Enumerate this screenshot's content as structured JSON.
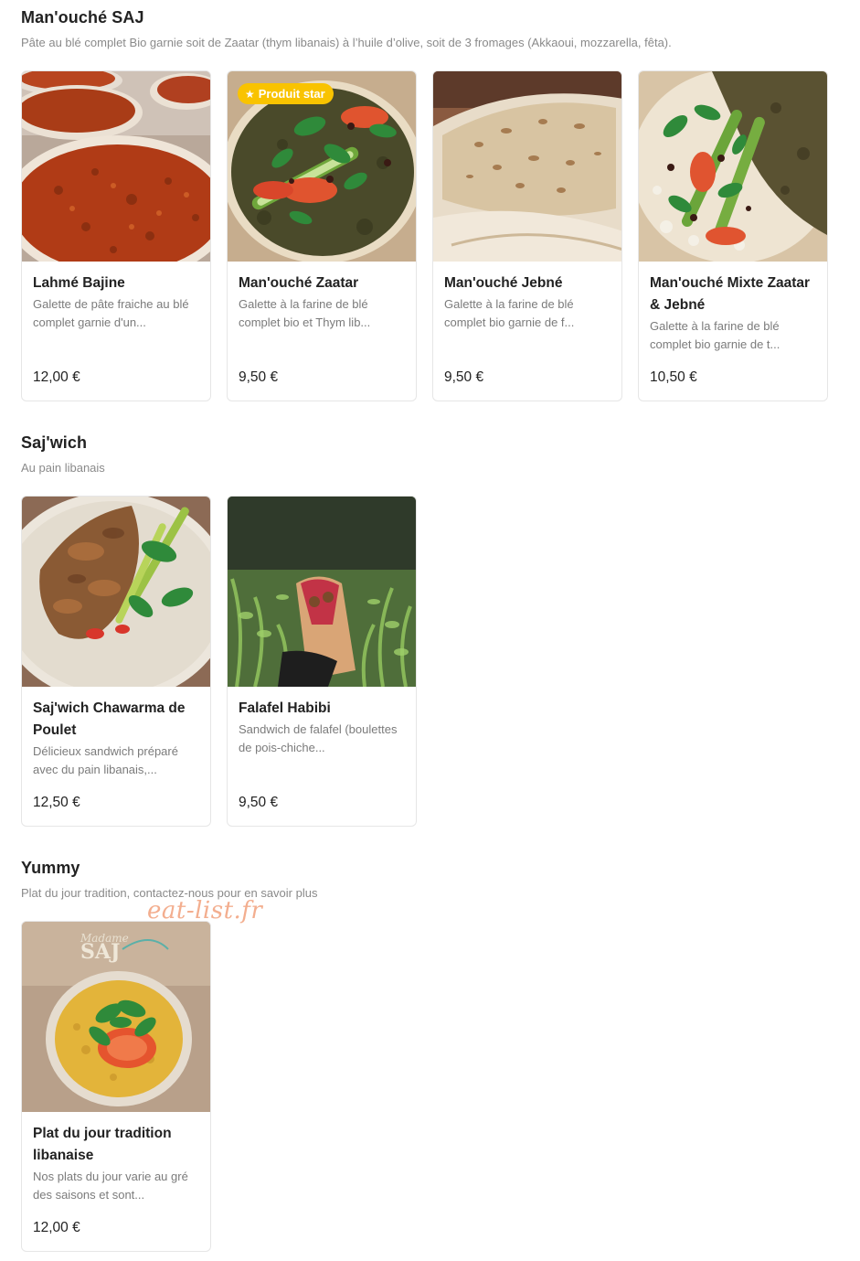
{
  "watermark": "eat-list.fr",
  "sections": [
    {
      "title": "Man'ouché SAJ",
      "description": "Pâte au blé complet Bio garnie soit de Zaatar (thym libanais) à l’huile d’olive, soit de 3 fromages (Akkaoui, mozzarella, fêta).",
      "items": [
        {
          "name": "Lahmé Bajine",
          "description": "Galette de pâte fraiche au blé complet garnie d'un...",
          "price": "12,00 €",
          "image": "meat-flatbread-photo"
        },
        {
          "name": "Man'ouché Zaatar",
          "description": "Galette à la farine de blé complet bio et Thym lib...",
          "price": "9,50 €",
          "image": "zaatar-flatbread-photo",
          "badge": "Produit star",
          "badge_icon": "star-icon"
        },
        {
          "name": "Man'ouché Jebné",
          "description": "Galette à la farine de blé complet bio garnie de f...",
          "price": "9,50 €",
          "image": "cheese-flatbread-photo"
        },
        {
          "name": "Man'ouché Mixte Zaatar & Jebné",
          "description": "Galette à la farine de blé complet bio garnie de t...",
          "price": "10,50 €",
          "image": "mixed-flatbread-photo"
        }
      ]
    },
    {
      "title": "Saj'wich",
      "description": "Au pain libanais",
      "items": [
        {
          "name": "Saj'wich Chawarma de Poulet",
          "description": "Délicieux sandwich préparé avec du pain libanais,...",
          "price": "12,50 €",
          "image": "chicken-shawarma-photo"
        },
        {
          "name": "Falafel Habibi",
          "description": "Sandwich de falafel (boulettes de pois-chiche...",
          "price": "9,50 €",
          "image": "falafel-wrap-photo"
        }
      ]
    },
    {
      "title": "Yummy",
      "description": "Plat du jour tradition, contactez-nous pour en savoir plus",
      "items": [
        {
          "name": "Plat du jour tradition libanaise",
          "description": "Nos plats du jour varie au gré des saisons et sont...",
          "price": "12,00 €",
          "image": "daily-dish-bowl-photo",
          "image_text": "Madame SAJ"
        }
      ]
    }
  ]
}
